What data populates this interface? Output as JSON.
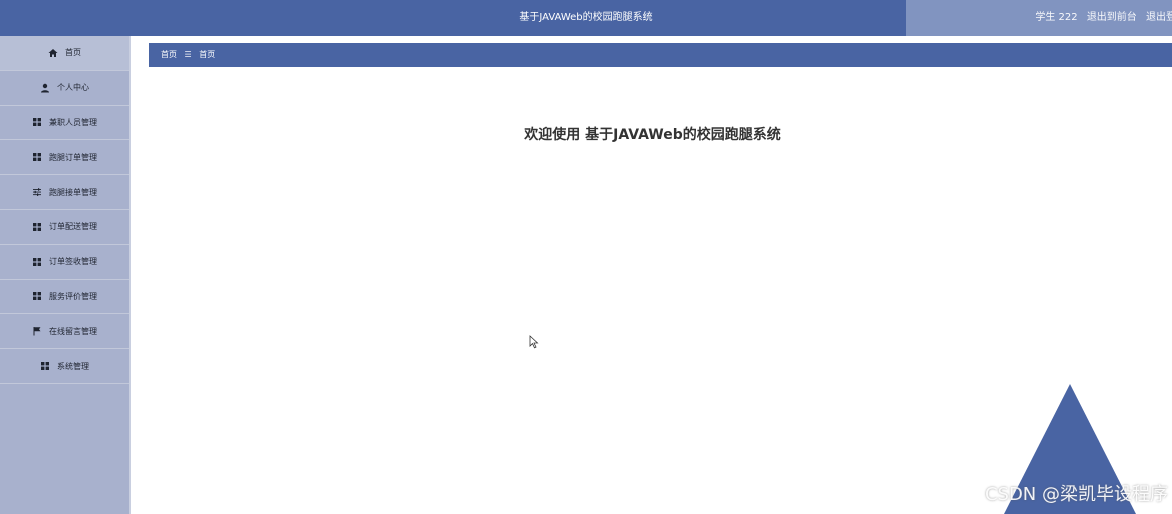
{
  "header": {
    "title": "基于JAVAWeb的校园跑腿系统",
    "user": "学生 222",
    "to_front": "退出到前台",
    "logout": "退出登录"
  },
  "sidebar": {
    "items": [
      {
        "label": "首页",
        "icon": "home-icon"
      },
      {
        "label": "个人中心",
        "icon": "user-icon"
      },
      {
        "label": "兼职人员管理",
        "icon": "grid-icon"
      },
      {
        "label": "跑腿订单管理",
        "icon": "grid-icon"
      },
      {
        "label": "跑腿接单管理",
        "icon": "sliders-icon"
      },
      {
        "label": "订单配送管理",
        "icon": "grid-icon"
      },
      {
        "label": "订单签收管理",
        "icon": "grid-icon"
      },
      {
        "label": "服务评价管理",
        "icon": "grid-icon"
      },
      {
        "label": "在线留言管理",
        "icon": "flag-icon"
      },
      {
        "label": "系统管理",
        "icon": "grid-icon"
      }
    ]
  },
  "breadcrumb": {
    "items": [
      "首页",
      "首页"
    ],
    "separator": "☰"
  },
  "main": {
    "welcome": "欢迎使用 基于JAVAWeb的校园跑腿系统"
  },
  "watermark": "CSDN @梁凯毕设程序",
  "colors": {
    "primary": "#4964a3",
    "sidebar": "#a8b1cd"
  }
}
